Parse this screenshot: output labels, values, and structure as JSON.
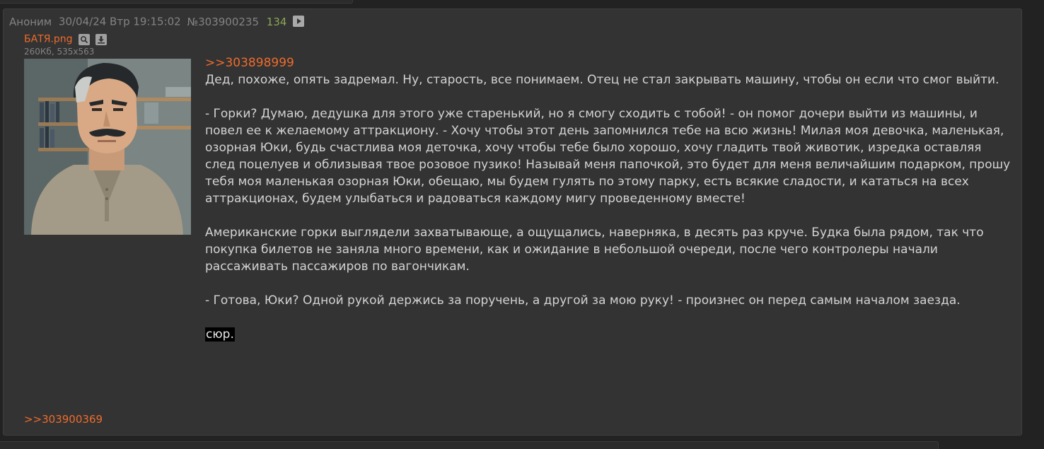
{
  "post": {
    "author": "Аноним",
    "datetime": "30/04/24 Втр 19:15:02",
    "number": "№303900235",
    "reply_count": "134",
    "file": {
      "name": "БАТЯ.png",
      "meta": "260Кб, 535x563",
      "search_icon": "magnifier-icon",
      "download_icon": "download-icon"
    },
    "reply_to": ">>303898999",
    "paragraphs": [
      "Дед, похоже, опять задремал. Ну, старость, все понимаем. Отец не стал закрывать машину, чтобы он если что смог выйти.",
      "- Горки? Думаю, дедушка для этого уже старенький, но я смогу сходить с тобой! - он помог дочери выйти из машины, и повел ее к желаемому аттракциону. - Хочу чтобы этот день запомнился тебе на всю жизнь! Милая моя девочка, маленькая, озорная Юки, будь счастлива моя деточка, хочу чтобы тебе было хорошо, хочу гладить твой животик, изредка оставляя след поцелуев и облизывая твое розовое пузико! Называй меня папочкой, это будет для меня величайшим подарком, прошу тебя моя маленькая озорная Юки, обещаю, мы будем гулять по этому парку, есть всякие сладости, и кататься на всех аттракционах, будем улыбаться и радоваться каждому мигу проведенному вместе!",
      "Американские горки выглядели захватывающе, а ощущались, наверняка, в десять раз круче. Будка была рядом, так что покупка билетов не заняла много времени, как и ожидание в небольшой очереди, после чего контролеры начали рассаживать пассажиров по вагончикам.",
      "- Готова, Юки? Одной рукой держись за поручень, а другой за мою руку! - произнес он перед самым началом заезда."
    ],
    "spoiler": "сюр.",
    "backlink": ">>303900369"
  }
}
